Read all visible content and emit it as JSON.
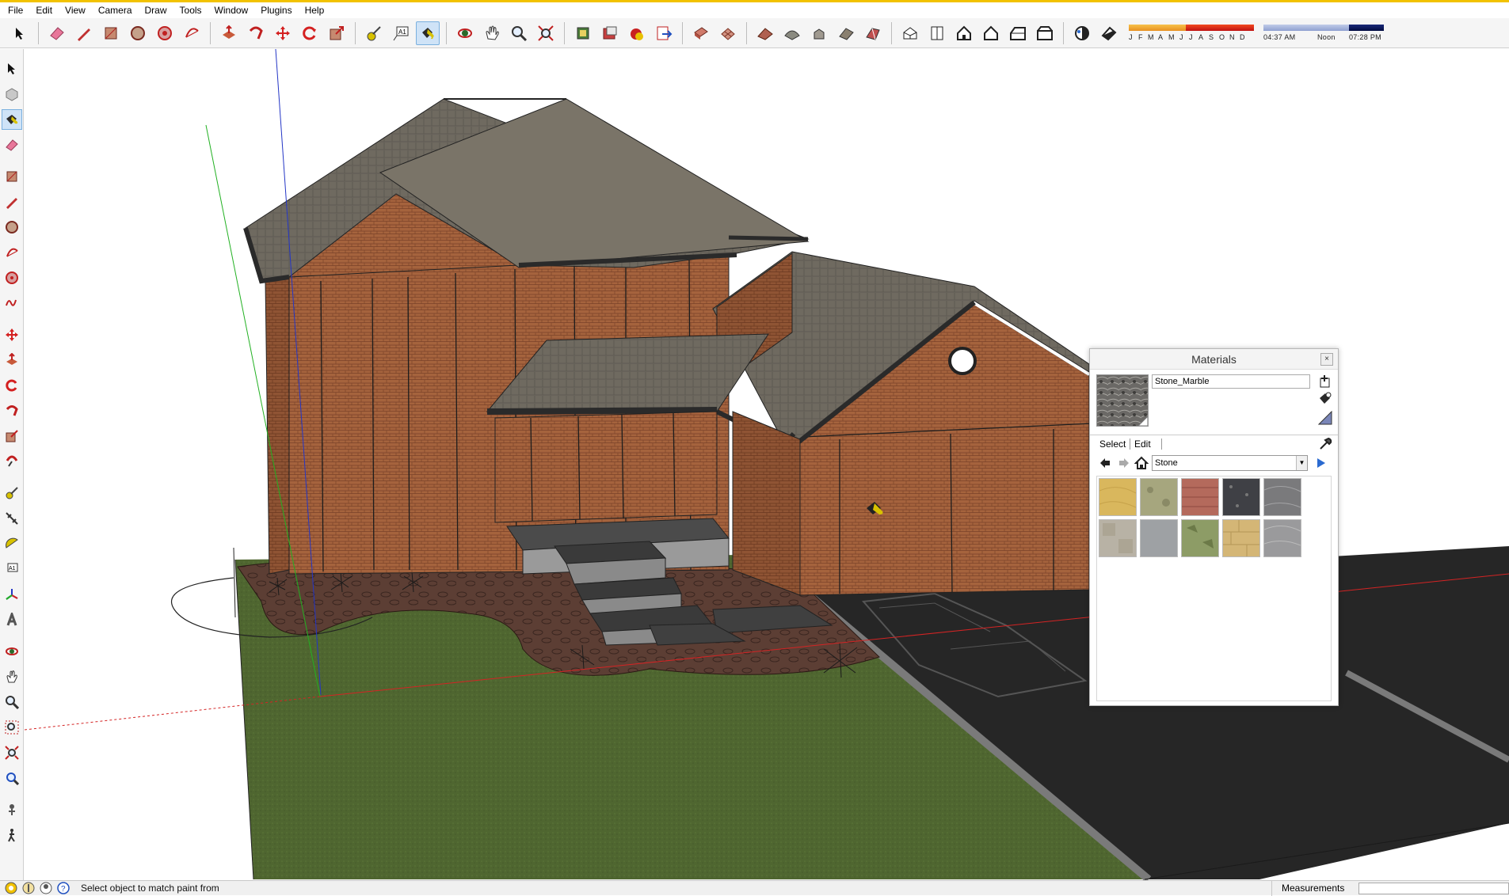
{
  "menu": [
    "File",
    "Edit",
    "View",
    "Camera",
    "Draw",
    "Tools",
    "Window",
    "Plugins",
    "Help"
  ],
  "shadow": {
    "months": [
      "J",
      "F",
      "M",
      "A",
      "M",
      "J",
      "J",
      "A",
      "S",
      "O",
      "N",
      "D"
    ],
    "time_start": "04:37 AM",
    "time_mid": "Noon",
    "time_end": "07:28 PM"
  },
  "status": {
    "hint": "Select object to match paint from",
    "measurements_label": "Measurements",
    "measurements_value": ""
  },
  "materials_panel": {
    "title": "Materials",
    "close_label": "×",
    "material_name": "Stone_Marble",
    "tab_select": "Select",
    "tab_edit": "Edit",
    "library": "Stone",
    "swatch_colors": [
      "#d9b75d",
      "#a6a67e",
      "#b46a5c",
      "#3f4045",
      "#7a7a7c",
      "#b8b2a5",
      "#9ea1a4",
      "#8d9c66",
      "#d4b676",
      "#9a9a9c"
    ]
  },
  "toolbar_icons": [
    "select-icon",
    "eraser-icon",
    "pencil-icon",
    "rectangle-icon",
    "circle-icon",
    "polygon-icon",
    "arc-icon",
    "push-pull-icon",
    "follow-me-icon",
    "move-icon",
    "rotate-icon",
    "scale-icon",
    "tape-measure-icon",
    "text-icon",
    "paint-bucket-icon",
    "orbit-icon",
    "pan-icon",
    "zoom-icon",
    "zoom-extents-icon",
    "3d-warehouse-icon",
    "component-icon",
    "share-icon",
    "send-to-layout-icon",
    "section-icon",
    "sandbox-icon",
    "from-contours-icon",
    "smoove-icon",
    "stamp-icon",
    "drape-icon",
    "flip-edge-icon",
    "iso-view-icon",
    "top-view-icon",
    "front-view-icon",
    "right-view-icon",
    "back-view-icon",
    "left-view-icon",
    "shadows-icon",
    "fog-icon"
  ],
  "colors": {
    "accent": "#f2c200",
    "active_tool_bg": "#cfe3f7",
    "axis_red": "#d42424",
    "axis_green": "#22b022",
    "axis_blue": "#2436c6",
    "roof": "#6b665c",
    "brick": "#a4623d",
    "grass": "#4f6630",
    "asphalt": "#262626"
  }
}
